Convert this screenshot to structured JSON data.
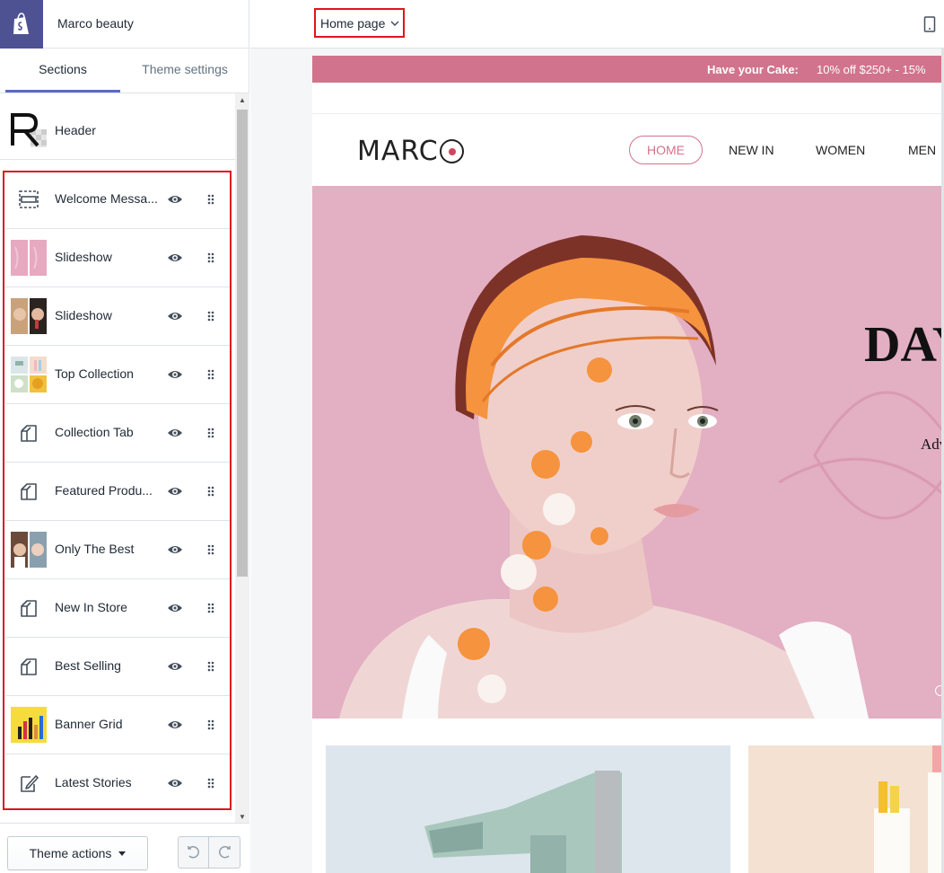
{
  "store": {
    "name": "Marco beauty"
  },
  "tabs": [
    {
      "label": "Sections"
    },
    {
      "label": "Theme settings"
    }
  ],
  "header_section": {
    "label": "Header"
  },
  "sections": [
    {
      "label": "Welcome Messa...",
      "icon": "announcement-bar-icon"
    },
    {
      "label": "Slideshow",
      "icon": "slideshow-thumbnail"
    },
    {
      "label": "Slideshow",
      "icon": "portrait-thumbnail"
    },
    {
      "label": "Top Collection",
      "icon": "collection-thumbnail"
    },
    {
      "label": "Collection Tab",
      "icon": "collection-icon"
    },
    {
      "label": "Featured Produ...",
      "icon": "collection-icon"
    },
    {
      "label": "Only The Best",
      "icon": "portrait-thumbnail"
    },
    {
      "label": "New In Store",
      "icon": "collection-icon"
    },
    {
      "label": "Best Selling",
      "icon": "collection-icon"
    },
    {
      "label": "Banner Grid",
      "icon": "banner-thumbnail"
    },
    {
      "label": "Latest Stories",
      "icon": "blog-icon"
    }
  ],
  "footer": {
    "theme_actions": "Theme actions"
  },
  "topbar": {
    "page_select": "Home page"
  },
  "preview": {
    "announcement": {
      "lead": "Have your Cake:",
      "offer": "10% off $250+  -  15%"
    },
    "nav": [
      "HOME",
      "NEW IN",
      "WOMEN",
      "MEN"
    ],
    "hero_title": "DAY",
    "hero_subtitle": "Adv"
  },
  "colors": {
    "accent": "#5c6ac4",
    "highlight": "#e0141b",
    "brand_pink": "#d1738c",
    "shopify_bg": "#4e5192"
  }
}
